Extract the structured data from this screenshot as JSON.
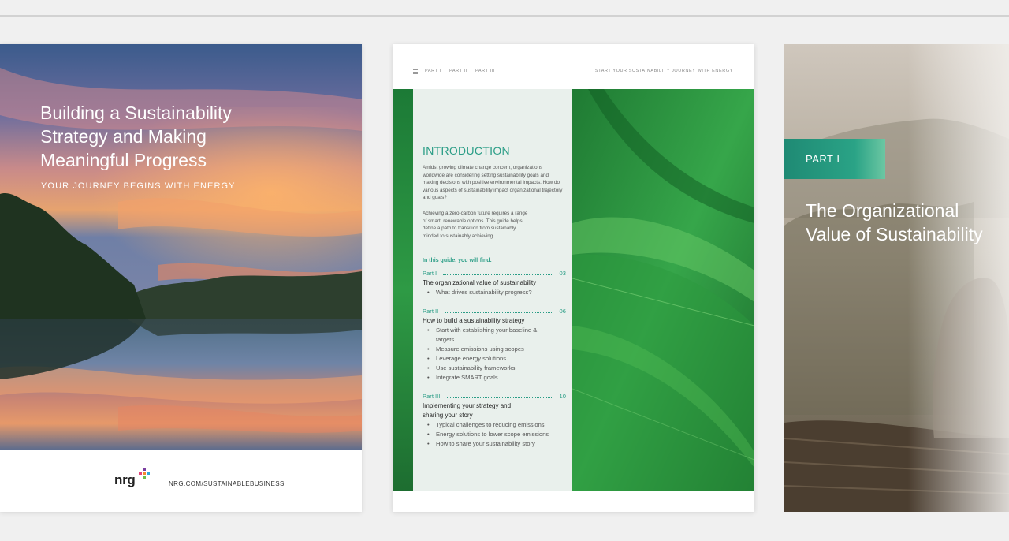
{
  "cover": {
    "title_lines": [
      "Building a Sustainability",
      "Strategy and Making",
      "Meaningful Progress"
    ],
    "subtitle": "YOUR JOURNEY BEGINS WITH ENERGY",
    "logo_text": "nrg",
    "url": "NRG.COM/SUSTAINABLEBUSINESS"
  },
  "intro": {
    "header": {
      "parts": [
        "PART I",
        "PART II",
        "PART III"
      ],
      "right": "START YOUR SUSTAINABILITY JOURNEY WITH ENERGY"
    },
    "heading": "INTRODUCTION",
    "paragraph1": "Amidst growing climate change concern, organizations worldwide are considering setting sustainability goals and making decisions with positive environmental impacts. How do various aspects of sustainability impact organizational trajectory and goals?",
    "paragraph2": "Achieving a zero-carbon future requires a range of smart, renewable options. This guide helps define a path to transition from sustainably minded to sustainably achieving.",
    "guide_label": "In this guide, you will find:",
    "toc": [
      {
        "part": "Part I",
        "page": "03",
        "title": "The organizational value of sustainability",
        "items": [
          "What drives sustainability progress?"
        ]
      },
      {
        "part": "Part II",
        "page": "06",
        "title": "How to build a sustainability strategy",
        "items": [
          "Start with establishing your baseline & targets",
          "Measure emissions using scopes",
          "Leverage energy solutions",
          "Use sustainability frameworks",
          "Integrate SMART goals"
        ]
      },
      {
        "part": "Part III",
        "page": "10",
        "title": "Implementing your strategy and sharing your story",
        "items": [
          "Typical challenges to reducing emissions",
          "Energy solutions to lower scope emissions",
          "How to share your sustainability story"
        ]
      }
    ]
  },
  "part_one": {
    "badge": "PART I",
    "title_lines": [
      "The Organizational",
      "Value of Sustainability"
    ]
  },
  "icons": {
    "menu": "hamburger-menu-icon",
    "logo_plus": "nrg-plus-logo-icon"
  },
  "colors": {
    "accent": "#2a9d86",
    "leaf_green": "#2e9a45",
    "page_bg": "#f0f0f0"
  }
}
